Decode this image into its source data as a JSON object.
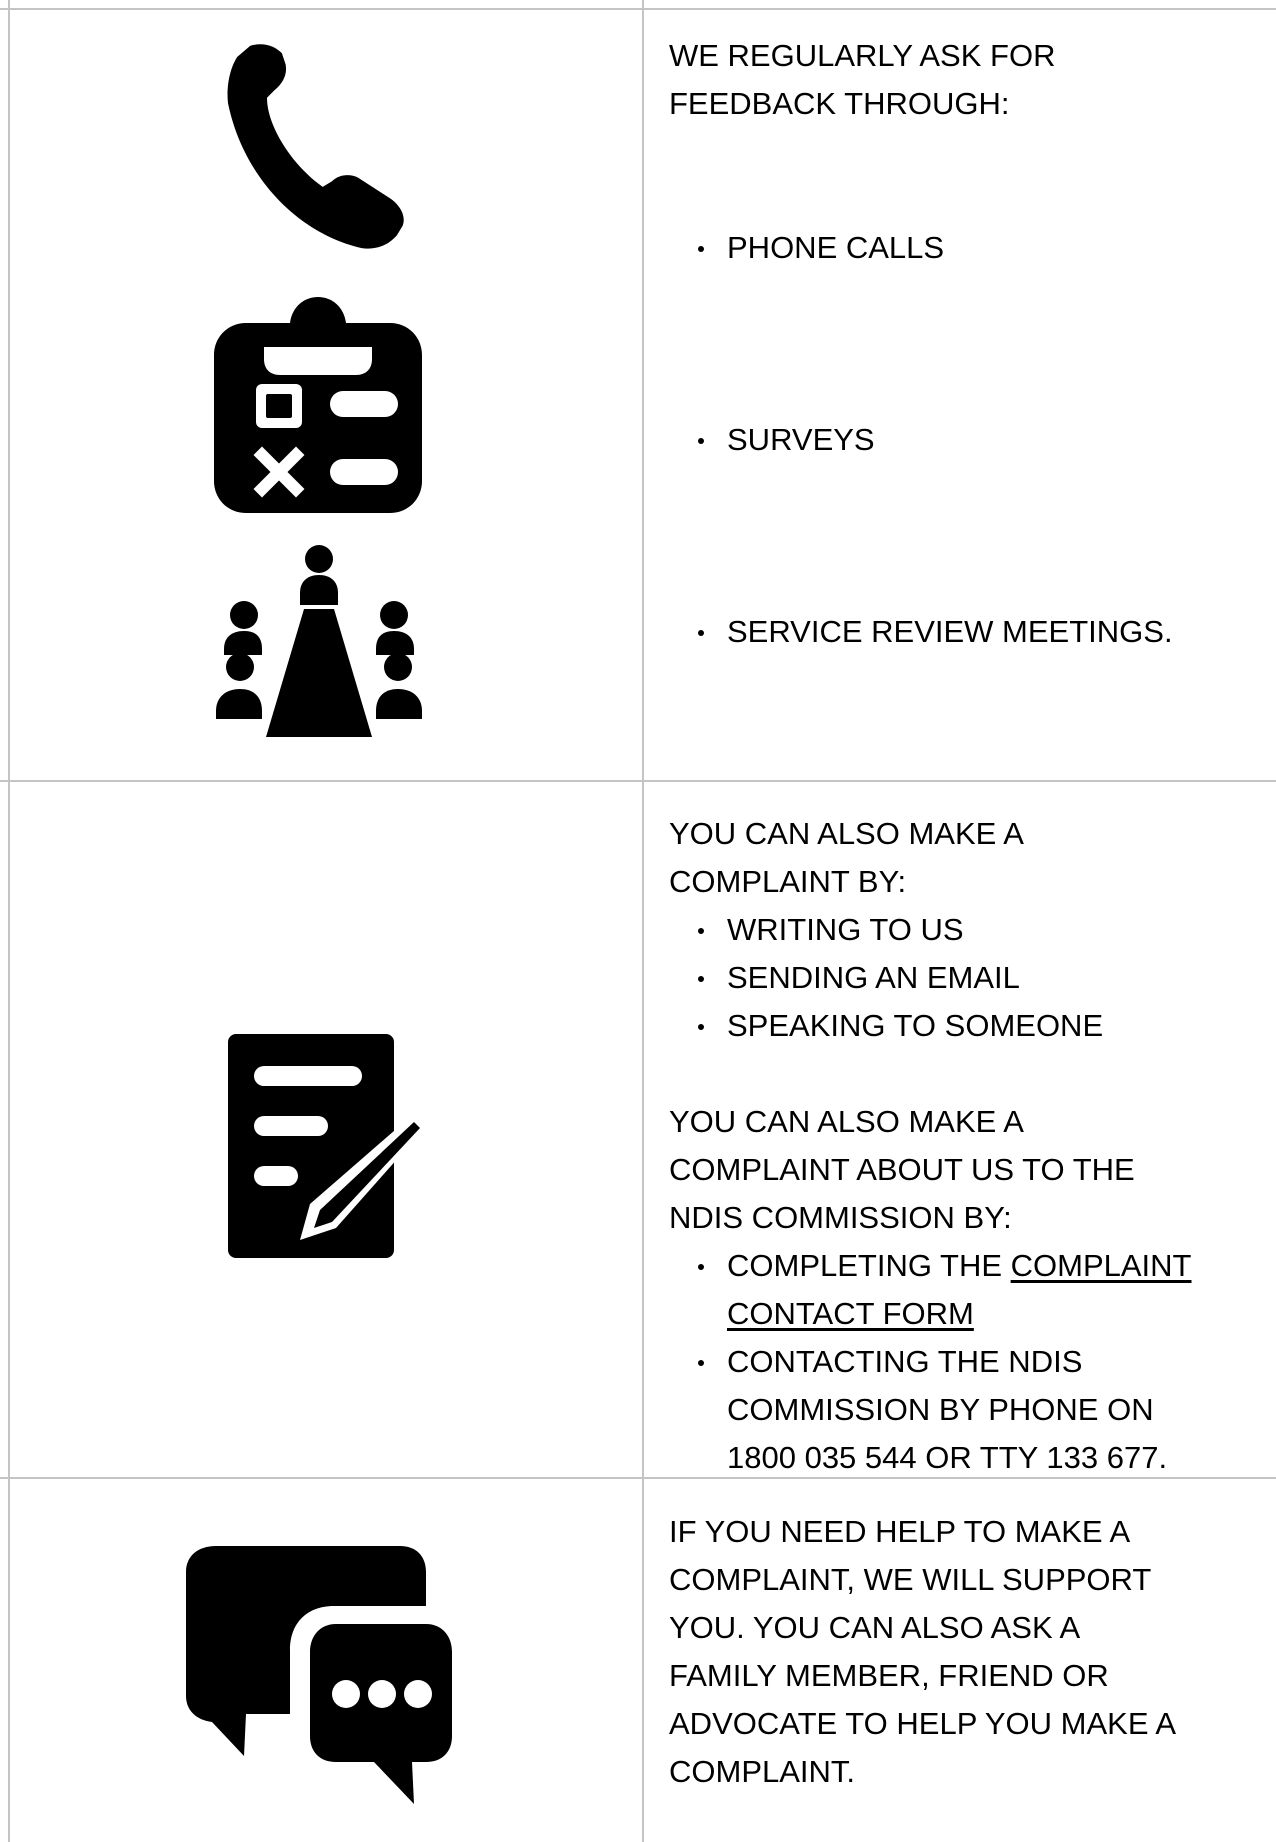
{
  "feedback": {
    "heading_line1": "WE REGULARLY ASK FOR",
    "heading_line2": "FEEDBACK THROUGH:",
    "items": [
      "PHONE CALLS",
      "SURVEYS",
      "SERVICE REVIEW MEETINGS."
    ]
  },
  "complaint_methods": {
    "intro_line1": "YOU CAN ALSO MAKE A",
    "intro_line2": "COMPLAINT BY:",
    "items": [
      "WRITING TO US",
      "SENDING AN EMAIL",
      "SPEAKING TO SOMEONE"
    ],
    "ndis_line1": "YOU CAN ALSO MAKE A",
    "ndis_line2": "COMPLAINT ABOUT US TO THE",
    "ndis_line3": "NDIS COMMISSION BY:",
    "form_prefix": "COMPLETING THE ",
    "form_link_line1": "COMPLAINT",
    "form_link_line2": "CONTACT FORM",
    "phone_line1": "CONTACTING THE NDIS",
    "phone_line2": "COMMISSION BY PHONE ON",
    "phone_line3": "1800 035 544 OR TTY 133 677."
  },
  "support": {
    "line1": "IF YOU NEED HELP TO MAKE A",
    "line2": "COMPLAINT, WE WILL SUPPORT",
    "line3": "YOU. YOU CAN ALSO ASK A",
    "line4": "FAMILY MEMBER, FRIEND OR",
    "line5": "ADVOCATE TO HELP YOU MAKE A",
    "line6": "COMPLAINT."
  },
  "icons": {
    "phone": "phone-icon",
    "survey": "survey-clipboard-icon",
    "meeting": "meeting-icon",
    "document": "document-edit-icon",
    "chat": "chat-bubbles-icon"
  },
  "colors": {
    "border": "#c4c4c4",
    "icon": "#000000",
    "text": "#000000"
  }
}
